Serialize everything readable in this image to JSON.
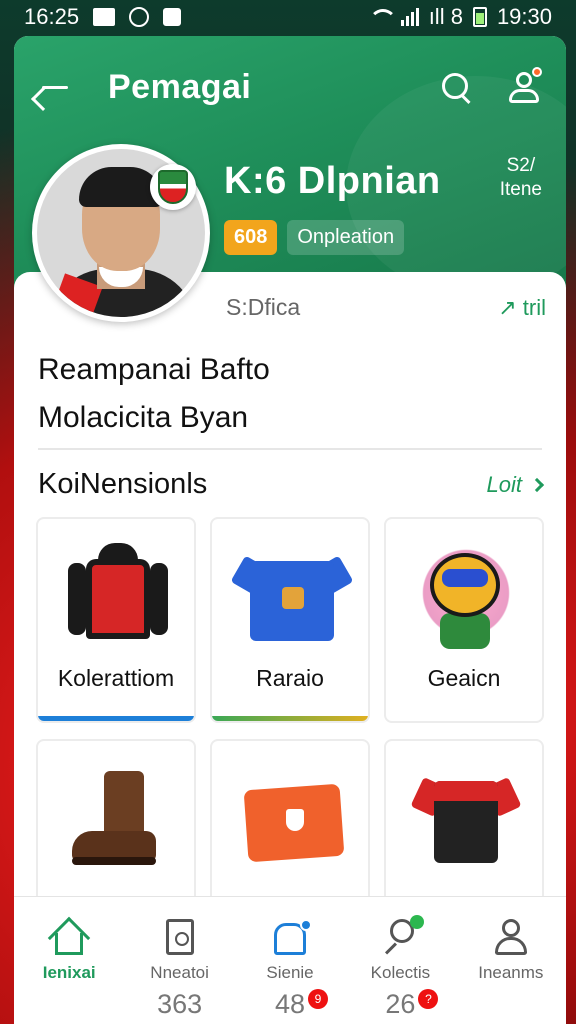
{
  "status_bar": {
    "time_left": "16:25",
    "time_right": "19:30",
    "signal_text": "ıll 8"
  },
  "header": {
    "title": "Pemagai"
  },
  "profile": {
    "name": "K:6 Dlpnian",
    "rank_line1": "S2/",
    "rank_line2": "Itene",
    "number_badge": "608",
    "position_badge": "Onpleation",
    "club": "S:Dfica",
    "club_link": "↗ tril",
    "about_line1": "Reampanai Bafto",
    "about_line2": "Molacicita Byan"
  },
  "collections": {
    "title": "KoiNensionls",
    "link": "Loit",
    "items": [
      {
        "label": "Kolerattiom",
        "bar_color": "#1d7fd8"
      },
      {
        "label": "Raraio",
        "bar_color": "#3aa856"
      },
      {
        "label": "Geaicn",
        "bar_color": ""
      },
      {
        "label": "",
        "bar_color": ""
      },
      {
        "label": "",
        "bar_color": ""
      },
      {
        "label": "",
        "bar_color": ""
      }
    ]
  },
  "bottom_nav": {
    "items": [
      {
        "label": "Ienixai",
        "count": ""
      },
      {
        "label": "Nneatoi",
        "count": "363"
      },
      {
        "label": "Sienie",
        "count": "48"
      },
      {
        "label": "Kolectis",
        "count": "26"
      },
      {
        "label": "Ineanms",
        "count": ""
      }
    ],
    "badge_2": "9",
    "badge_3": "?",
    "active_color": "#1f9a5c"
  },
  "icons": {
    "back": "arrow-left-icon",
    "search": "search-icon",
    "user": "user-settings-icon"
  }
}
